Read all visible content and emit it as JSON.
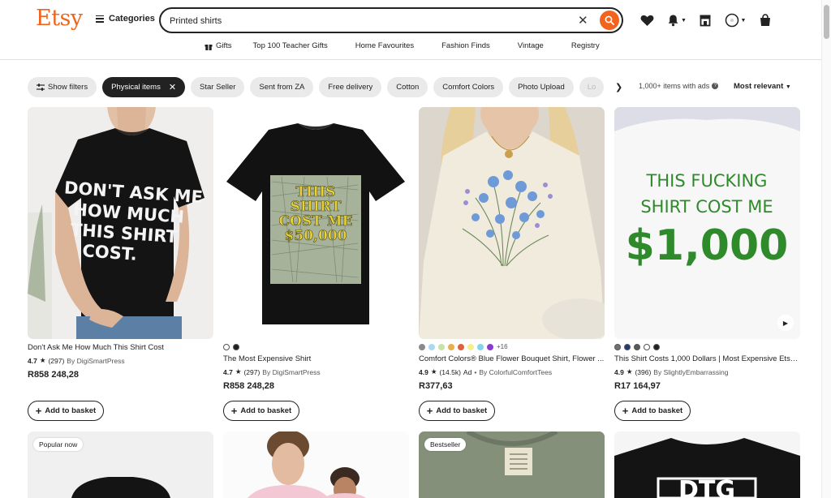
{
  "header": {
    "logo": "Etsy",
    "categories_label": "Categories",
    "search_value": "Printed shirts",
    "nav": [
      "Gifts",
      "Top 100 Teacher Gifts",
      "Home Favourites",
      "Fashion Finds",
      "Vintage",
      "Registry"
    ]
  },
  "filters": {
    "chips": [
      "Show filters",
      "Physical items",
      "Star Seller",
      "Sent from ZA",
      "Free delivery",
      "Cotton",
      "Comfort Colors",
      "Photo Upload",
      "Lo"
    ],
    "items_count": "1,000+ items with ads",
    "sort": "Most relevant"
  },
  "add_label": "Add to basket",
  "products": [
    {
      "title": "Don't Ask Me How Much This Shirt Cost",
      "rating": "4.7",
      "reviews": "(297)",
      "shop": "By DigiSmartPress",
      "price": "R858 248,28",
      "shirt_text": [
        "DON'T ASK ME",
        "HOW MUCH",
        "THIS SHIRT",
        "COST."
      ]
    },
    {
      "title": "The Most Expensive Shirt",
      "rating": "4.7",
      "reviews": "(297)",
      "shop": "By DigiSmartPress",
      "price": "R858 248,28",
      "shirt_text": [
        "THIS",
        "SHIRT",
        "COST ME",
        "$50,000"
      ],
      "swatches": [
        "#ffffff",
        "#222222"
      ]
    },
    {
      "title": "Comfort Colors® Blue Flower Bouquet Shirt, Flower ...",
      "rating": "4.9",
      "reviews": "(14.5k)",
      "ad": "Ad",
      "shop": "By ColorfulComfortTees",
      "price": "R377,63",
      "swatches": [
        "#8a8a8a",
        "#a9d9f2",
        "#c9e3a5",
        "#e8b04a",
        "#e0623b",
        "#f4ef8a",
        "#7fd6e8",
        "#8a3bd0"
      ],
      "more_colors": "+16"
    },
    {
      "title": "This Shirt Costs 1,000 Dollars | Most Expensive Etsy ...",
      "rating": "4.9",
      "reviews": "(396)",
      "shop": "By SlightlyEmbarrassing",
      "price": "R17 164,97",
      "shirt_text": [
        "THIS FUCKING",
        "SHIRT COST ME",
        "$1,000"
      ],
      "swatches": [
        "#6f7373",
        "#253c73",
        "#5a5a5a",
        "#ffffff",
        "#222222"
      ]
    }
  ],
  "row2_badges": [
    "Popular now",
    "Bestseller"
  ],
  "row2_shirt_text": "DTG"
}
